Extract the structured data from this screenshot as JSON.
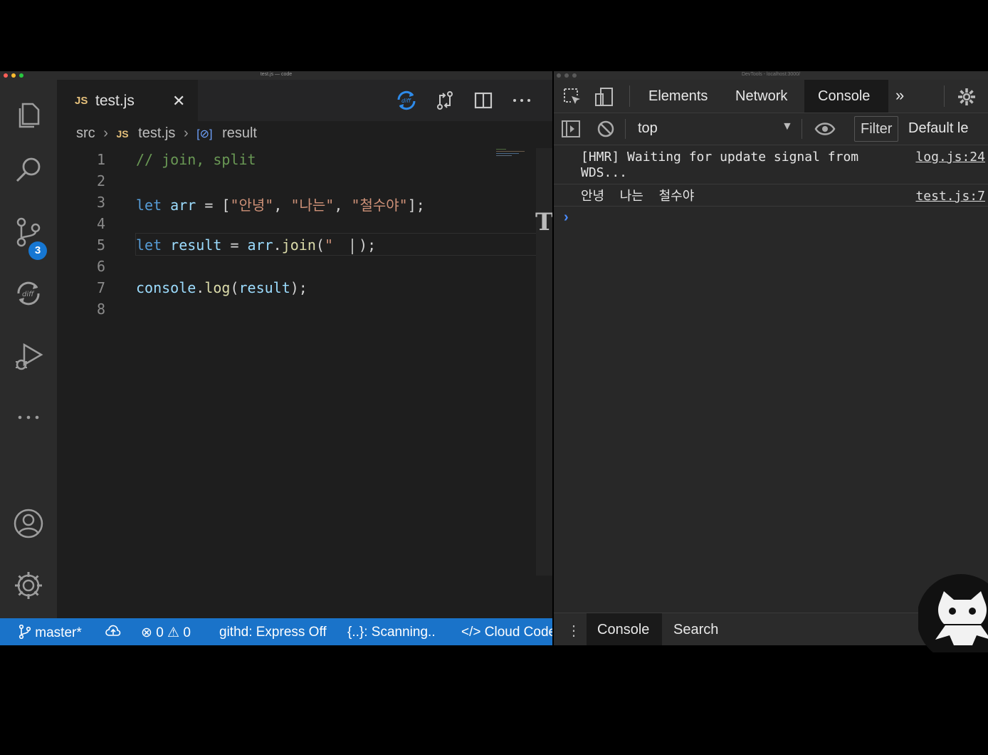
{
  "vscode": {
    "window_title": "test.js — code",
    "tab": {
      "badge": "JS",
      "name": "test.js",
      "close": "✕"
    },
    "breadcrumb": {
      "folder": "src",
      "file_badge": "JS",
      "file": "test.js",
      "symbol_icon": "[⊘]",
      "symbol": "result"
    },
    "activity_badge": "3",
    "lines": [
      {
        "n": "1",
        "code": "// join, split"
      },
      {
        "n": "2",
        "code": ""
      },
      {
        "n": "3",
        "code": "let arr = [\"안녕\", \"나는\", \"철수야\"];"
      },
      {
        "n": "4",
        "code": ""
      },
      {
        "n": "5",
        "code": "let result = arr.join(\" \");"
      },
      {
        "n": "6",
        "code": ""
      },
      {
        "n": "7",
        "code": "console.log(result);"
      },
      {
        "n": "8",
        "code": ""
      }
    ],
    "tokens": {
      "l1": "// join, split",
      "l3_kw": "let",
      "l3_var": "arr",
      "l3_eq": " = [",
      "l3_s1": "\"안녕\"",
      "l3_c1": ", ",
      "l3_s2": "\"나는\"",
      "l3_c2": ", ",
      "l3_s3": "\"철수야\"",
      "l3_end": "];",
      "l5_kw": "let",
      "l5_var": "result",
      "l5_eq": " = ",
      "l5_obj": "arr",
      "l5_dot": ".",
      "l5_fn": "join",
      "l5_open": "(",
      "l5_str": "\" ",
      "l5_close": ");",
      "l7_obj": "console",
      "l7_dot": ".",
      "l7_fn": "log",
      "l7_open": "(",
      "l7_var": "result",
      "l7_close": ");"
    },
    "statusbar": {
      "branch": "master*",
      "problems": "⊗ 0 ⚠ 0",
      "githd": "githd: Express Off",
      "scanning": "{..}: Scanning..",
      "cloud": "</> Cloud Code"
    },
    "colors": {
      "statusbar": "#1a73c9",
      "editor_bg": "#1e1e1e"
    }
  },
  "devtools": {
    "window_title": "DevTools - localhost:3000/",
    "tabs": [
      "Elements",
      "Network",
      "Console"
    ],
    "active_tab": "Console",
    "more_tabs": "»",
    "context": "top",
    "filter_placeholder": "Filter",
    "levels": "Default le",
    "messages": [
      {
        "text": "[HMR] Waiting for update signal from WDS...",
        "source": "log.js:24"
      },
      {
        "text": "안녕  나는  철수야",
        "source": "test.js:7"
      }
    ],
    "prompt": "›",
    "drawer_tabs": [
      "Console",
      "Search"
    ],
    "drawer_menu": "⋮"
  }
}
